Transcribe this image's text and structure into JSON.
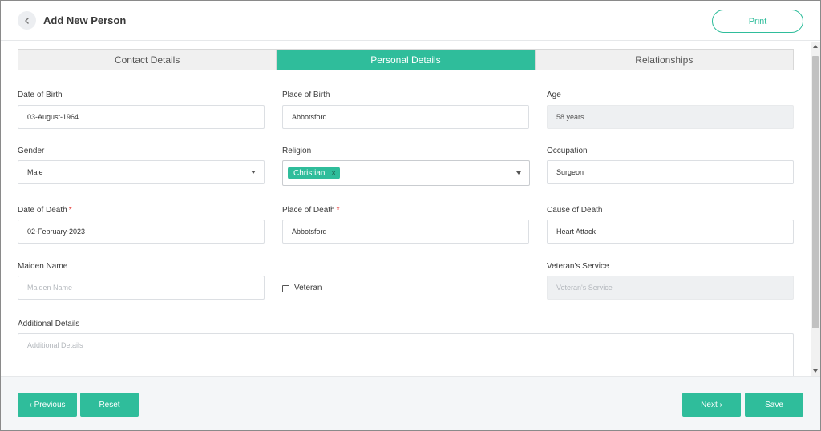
{
  "header": {
    "title": "Add New Person",
    "print_label": "Print",
    "back_icon": "chevron-left-icon"
  },
  "tabs": [
    {
      "label": "Contact Details",
      "active": false
    },
    {
      "label": "Personal Details",
      "active": true
    },
    {
      "label": "Relationships",
      "active": false
    }
  ],
  "form": {
    "date_of_birth": {
      "label": "Date of Birth",
      "value": "03-August-1964"
    },
    "place_of_birth": {
      "label": "Place of Birth",
      "value": "Abbotsford"
    },
    "age": {
      "label": "Age",
      "value": "58 years"
    },
    "gender": {
      "label": "Gender",
      "value": "Male"
    },
    "religion": {
      "label": "Religion",
      "chip": "Christian",
      "chip_remove": "×"
    },
    "occupation": {
      "label": "Occupation",
      "value": "Surgeon"
    },
    "date_of_death": {
      "label": "Date of Death",
      "value": "02-February-2023",
      "required_mark": "*"
    },
    "place_of_death": {
      "label": "Place of Death",
      "value": "Abbotsford",
      "required_mark": "*"
    },
    "cause_of_death": {
      "label": "Cause of Death",
      "value": "Heart Attack"
    },
    "maiden_name": {
      "label": "Maiden Name",
      "placeholder": "Maiden Name"
    },
    "veteran": {
      "label": "Veteran",
      "checked": false
    },
    "veterans_service": {
      "label": "Veteran's Service",
      "placeholder": "Veteran's Service"
    },
    "additional_details": {
      "label": "Additional Details",
      "placeholder": "Additional Details"
    }
  },
  "footer": {
    "previous_label": "‹ Previous",
    "reset_label": "Reset",
    "next_label": "Next ›",
    "save_label": "Save"
  },
  "colors": {
    "accent": "#2fbd9b",
    "required": "#e53935",
    "disabled_bg": "#eef0f2"
  }
}
